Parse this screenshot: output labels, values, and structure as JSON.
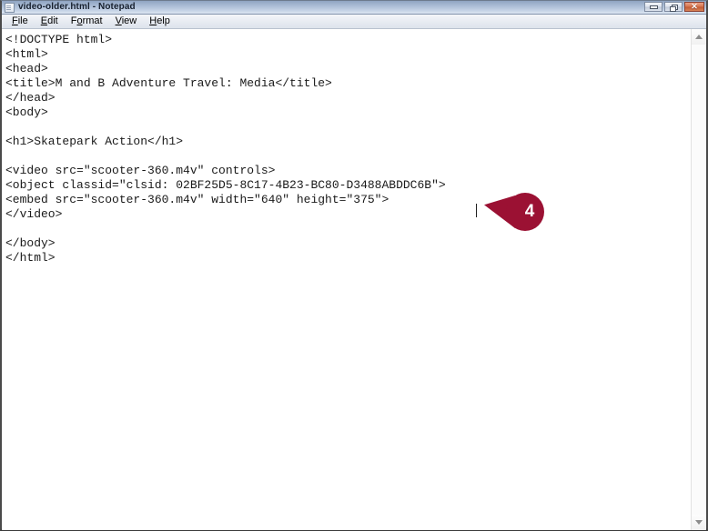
{
  "window": {
    "title": "video-older.html - Notepad",
    "icon": "notepad-document-icon",
    "controls": {
      "minimize_label": "Minimize",
      "restore_label": "Restore",
      "close_label": "Close",
      "close_glyph": "✕",
      "close_color": "#c25c36",
      "titlebar_color": "#b6c6dd"
    }
  },
  "menubar": {
    "items": [
      {
        "label": "File",
        "accesskey": "F",
        "rest": "ile"
      },
      {
        "label": "Edit",
        "accesskey": "E",
        "rest": "dit"
      },
      {
        "label": "Format",
        "accesskey": "o",
        "pre": "F",
        "rest": "rmat"
      },
      {
        "label": "View",
        "accesskey": "V",
        "rest": "iew"
      },
      {
        "label": "Help",
        "accesskey": "H",
        "rest": "elp"
      }
    ]
  },
  "editor": {
    "filename": "video-older.html",
    "lines": [
      "<!DOCTYPE html>",
      "<html>",
      "<head>",
      "<title>M and B Adventure Travel: Media</title>",
      "</head>",
      "<body>",
      "",
      "<h1>Skatepark Action</h1>",
      "",
      "<video src=\"scooter-360.m4v\" controls>",
      "<object classid=\"clsid: 02BF25D5-8C17-4B23-BC80-D3488ABDDC6B\">",
      "<embed src=\"scooter-360.m4v\" width=\"640\" height=\"375\">",
      "</video>",
      "",
      "</body>",
      "</html>"
    ],
    "text": "<!DOCTYPE html>\n<html>\n<head>\n<title>M and B Adventure Travel: Media</title>\n</head>\n<body>\n\n<h1>Skatepark Action</h1>\n\n<video src=\"scooter-360.m4v\" controls>\n<object classid=\"clsid: 02BF25D5-8C17-4B23-BC80-D3488ABDDC6B\">\n<embed src=\"scooter-360.m4v\" width=\"640\" height=\"375\">\n</video>\n\n</body>\n</html>",
    "caret_line": 11,
    "caret_after": "<object classid=\"clsid: 02BF25D5-8C17-4B23-BC80-D3488ABDDC6B\">"
  },
  "callout": {
    "number": "4",
    "color": "#9b1133",
    "points_to_line": "<object classid=\"clsid: 02BF25D5-8C17-4B23-BC80-D3488ABDDC6B\">"
  },
  "scrollbar": {
    "up_arrow": "scroll-up-arrow",
    "down_arrow": "scroll-down-arrow",
    "position": "top"
  }
}
